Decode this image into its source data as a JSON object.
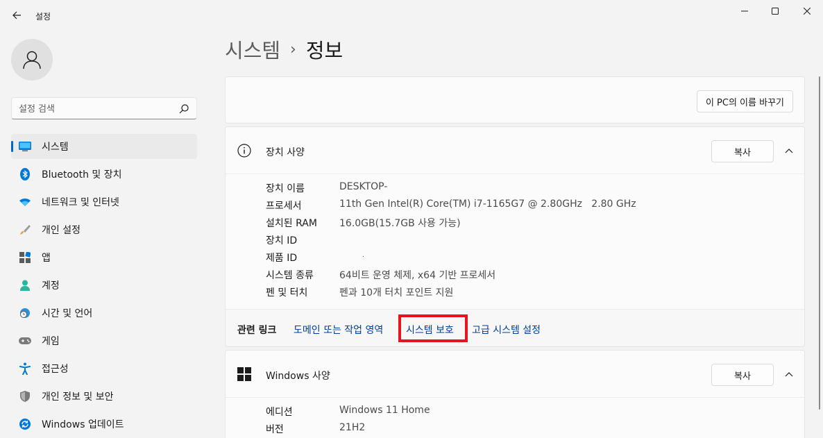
{
  "window": {
    "title": "설정"
  },
  "sidebar": {
    "search_placeholder": "설정 검색",
    "items": [
      {
        "label": "시스템",
        "icon": "monitor-icon",
        "active": true
      },
      {
        "label": "Bluetooth 및 장치",
        "icon": "bluetooth-icon"
      },
      {
        "label": "네트워크 및 인터넷",
        "icon": "wifi-icon"
      },
      {
        "label": "개인 설정",
        "icon": "brush-icon"
      },
      {
        "label": "앱",
        "icon": "apps-icon"
      },
      {
        "label": "계정",
        "icon": "person-icon"
      },
      {
        "label": "시간 및 언어",
        "icon": "globe-clock-icon"
      },
      {
        "label": "게임",
        "icon": "gamepad-icon"
      },
      {
        "label": "접근성",
        "icon": "accessibility-icon"
      },
      {
        "label": "개인 정보 및 보안",
        "icon": "shield-icon"
      },
      {
        "label": "Windows 업데이트",
        "icon": "update-icon"
      }
    ]
  },
  "breadcrumb": {
    "parent": "시스템",
    "separator": "›",
    "current": "정보"
  },
  "rename_button": "이 PC의 이름 바꾸기",
  "device_specs": {
    "title": "장치 사양",
    "copy_label": "복사",
    "rows": [
      {
        "key": "장치 이름",
        "value": "DESKTOP-"
      },
      {
        "key": "프로세서",
        "value": "11th Gen Intel(R) Core(TM) i7-1165G7 @ 2.80GHz   2.80 GHz"
      },
      {
        "key": "설치된 RAM",
        "value": "16.0GB(15.7GB 사용 가능)"
      },
      {
        "key": "장치 ID",
        "value": ""
      },
      {
        "key": "제품 ID",
        "value": "."
      },
      {
        "key": "시스템 종류",
        "value": "64비트 운영 체제, x64 기반 프로세서"
      },
      {
        "key": "펜 및 터치",
        "value": "펜과 10개 터치 포인트 지원"
      }
    ]
  },
  "related_links": {
    "label": "관련 링크",
    "links": [
      "도메인 또는 작업 영역",
      "시스템 보호",
      "고급 시스템 설정"
    ]
  },
  "windows_specs": {
    "title": "Windows 사양",
    "copy_label": "복사",
    "rows": [
      {
        "key": "에디션",
        "value": "Windows 11 Home"
      },
      {
        "key": "버전",
        "value": "21H2"
      }
    ]
  },
  "colors": {
    "accent": "#0067c0",
    "link": "#003e92",
    "highlight": "#e4161d"
  }
}
